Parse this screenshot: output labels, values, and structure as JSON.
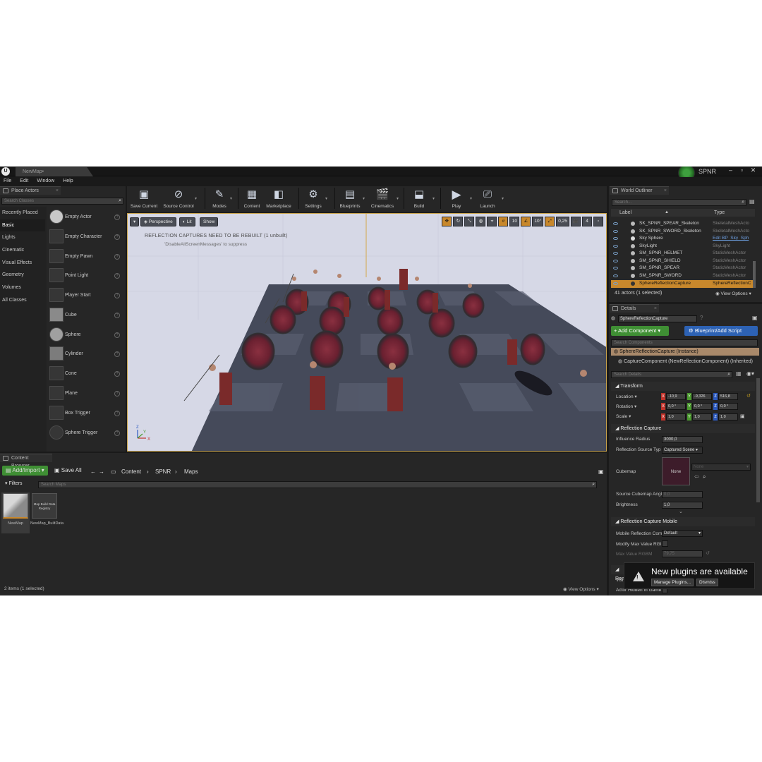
{
  "window": {
    "tab_title": "NewMap•",
    "project_name": "SPNR",
    "logo": "U",
    "minimize": "–",
    "maximize": "▫",
    "close": "✕"
  },
  "menu": [
    "File",
    "Edit",
    "Window",
    "Help"
  ],
  "place_actors": {
    "tab_label": "Place Actors",
    "search_placeholder": "Search Classes",
    "categories": [
      "Recently Placed",
      "Basic",
      "Lights",
      "Cinematic",
      "Visual Effects",
      "Geometry",
      "Volumes",
      "All Classes"
    ],
    "active_category": "Basic",
    "actors": [
      {
        "label": "Empty Actor",
        "icon": "sphere-thumb-icon"
      },
      {
        "label": "Empty Character",
        "icon": "character-thumb-icon"
      },
      {
        "label": "Empty Pawn",
        "icon": "pawn-thumb-icon"
      },
      {
        "label": "Point Light",
        "icon": "light-bulb-icon"
      },
      {
        "label": "Player Start",
        "icon": "player-start-icon"
      },
      {
        "label": "Cube",
        "icon": "cube-icon"
      },
      {
        "label": "Sphere",
        "icon": "sphere-icon"
      },
      {
        "label": "Cylinder",
        "icon": "cylinder-icon"
      },
      {
        "label": "Cone",
        "icon": "cone-icon"
      },
      {
        "label": "Plane",
        "icon": "plane-icon"
      },
      {
        "label": "Box Trigger",
        "icon": "box-trigger-icon"
      },
      {
        "label": "Sphere Trigger",
        "icon": "sphere-trigger-icon"
      }
    ]
  },
  "toolbar": [
    {
      "label": "Save Current",
      "icon": "save-icon"
    },
    {
      "label": "Source Control",
      "icon": "source-control-icon"
    },
    {
      "label": "Modes",
      "icon": "modes-icon"
    },
    {
      "label": "Content",
      "icon": "content-icon"
    },
    {
      "label": "Marketplace",
      "icon": "marketplace-icon"
    },
    {
      "label": "Settings",
      "icon": "settings-icon"
    },
    {
      "label": "Blueprints",
      "icon": "blueprints-icon"
    },
    {
      "label": "Cinematics",
      "icon": "cinematics-icon"
    },
    {
      "label": "Build",
      "icon": "build-icon"
    },
    {
      "label": "Play",
      "icon": "play-icon"
    },
    {
      "label": "Launch",
      "icon": "launch-icon"
    }
  ],
  "viewport": {
    "perspective_label": "Perspective",
    "lit_label": "Lit",
    "show_label": "Show",
    "warning_line1": "REFLECTION CAPTURES NEED TO BE REBUILT (1 unbuilt)",
    "warning_line2": "'DisableAllScreenMessages' to suppress",
    "grid_snap": "10",
    "rotation_snap": "10°",
    "scale_snap": "0,25",
    "camera_speed": "4",
    "axis_x": "X",
    "axis_y": "Y",
    "axis_z": "Z"
  },
  "content_browser": {
    "tab_label": "Content Browser",
    "add_import_label": "Add/Import",
    "save_all_label": "Save All",
    "breadcrumbs": [
      "Content",
      "SPNR",
      "Maps"
    ],
    "filters_label": "Filters",
    "search_placeholder": "Search Maps",
    "assets": [
      {
        "name": "NewMap",
        "thumb_text": ""
      },
      {
        "name": "NewMap_BuiltData",
        "thumb_text": "Map Build Data Registry"
      }
    ],
    "status": "2 items (1 selected)",
    "view_options": "View Options"
  },
  "world_outliner": {
    "tab_label": "World Outliner",
    "search_placeholder": "Search...",
    "col_label": "Label",
    "col_type": "Type",
    "rows": [
      {
        "label": "SK_SPNR_SPEAR_Skeleton",
        "type": "SkeletalMeshActo"
      },
      {
        "label": "SK_SPNR_SWORD_Skeleton",
        "type": "SkeletalMeshActo"
      },
      {
        "label": "Sky Sphere",
        "type": "Edit BP_Sky_Sph"
      },
      {
        "label": "SkyLight",
        "type": "SkyLight"
      },
      {
        "label": "SM_SPNR_HELMET",
        "type": "StaticMeshActor"
      },
      {
        "label": "SM_SPNR_SHIELD",
        "type": "StaticMeshActor"
      },
      {
        "label": "SM_SPNR_SPEAR",
        "type": "StaticMeshActor"
      },
      {
        "label": "SM_SPNR_SWORD",
        "type": "StaticMeshActor"
      },
      {
        "label": "SphereReflectionCapture",
        "type": "SphereReflectionC"
      }
    ],
    "selected_index": 8,
    "status": "41 actors (1 selected)",
    "view_options": "View Options"
  },
  "details": {
    "tab_label": "Details",
    "name_value": "SphereReflectionCapture",
    "add_component_label": "+ Add Component",
    "blueprint_label": "Blueprint/Add Script",
    "search_components_placeholder": "Search Components",
    "instance_label": "SphereReflectionCapture (Instance)",
    "component_label": "CaptureComponent (NewReflectionComponent) (Inherited)",
    "search_details_placeholder": "Search Details",
    "transform": {
      "title": "Transform",
      "location_label": "Location",
      "rotation_label": "Rotation",
      "scale_label": "Scale",
      "location": [
        "-10,9",
        "-9,326",
        "516,8"
      ],
      "rotation": [
        "0,0 °",
        "0,0 °",
        "0,0 °"
      ],
      "scale": [
        "1,0",
        "1,0",
        "1,0"
      ]
    },
    "reflection_capture": {
      "title": "Reflection Capture",
      "influence_radius_label": "Influence Radius",
      "influence_radius": "3000,0",
      "source_type_label": "Reflection Source Typ",
      "source_type": "Captured Scene",
      "cubemap_label": "Cubemap",
      "cubemap_thumb": "None",
      "cubemap_value": "None",
      "source_angle_label": "Source Cubemap Angl",
      "source_angle": "0,0",
      "brightness_label": "Brightness",
      "brightness": "1,0"
    },
    "reflection_capture_mobile": {
      "title": "Reflection Capture Mobile",
      "mobile_label": "Mobile Reflection Com",
      "mobile_value": "Default",
      "modify_max_label": "Modify Max Value RGI",
      "max_value_label": "Max Value RGBM",
      "max_value": "79,75"
    },
    "render_section_title": "Rend",
    "visible_label": "Visi",
    "hidden_label": "Actor Hidden In Game"
  },
  "notification": {
    "message": "New plugins are available",
    "manage_label": "Manage Plugins...",
    "dismiss_label": "Dismiss"
  },
  "colors": {
    "accent_orange": "#c8882c",
    "add_component_green": "#3f8f34",
    "blueprint_blue": "#2d62b4"
  }
}
